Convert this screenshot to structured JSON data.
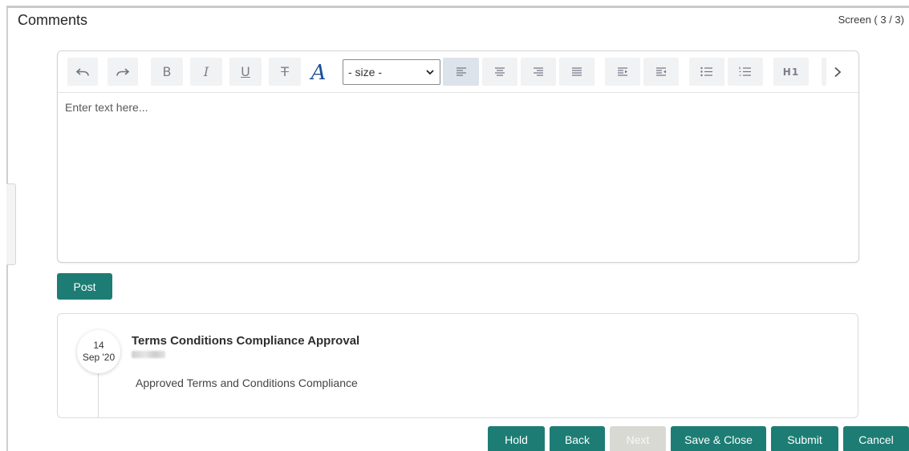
{
  "header": {
    "title": "Comments",
    "screen_indicator": "Screen ( 3 / 3)"
  },
  "editor": {
    "placeholder": "Enter text here...",
    "toolbar": {
      "size_select_value": "- size -",
      "heading_label": "H1",
      "font_color_glyph": "A",
      "tools": [
        {
          "name": "undo-icon"
        },
        {
          "name": "redo-icon"
        },
        {
          "name": "bold-icon",
          "glyph": "B"
        },
        {
          "name": "italic-icon",
          "glyph": "I"
        },
        {
          "name": "underline-icon",
          "glyph": "U"
        },
        {
          "name": "strikethrough-icon",
          "glyph": "T"
        },
        {
          "name": "font-color-icon"
        },
        {
          "name": "align-left-icon",
          "active": true
        },
        {
          "name": "align-center-icon"
        },
        {
          "name": "align-right-icon"
        },
        {
          "name": "align-justify-icon"
        },
        {
          "name": "indent-icon"
        },
        {
          "name": "outdent-icon"
        },
        {
          "name": "bullet-list-icon"
        },
        {
          "name": "numbered-list-icon"
        },
        {
          "name": "heading-icon"
        },
        {
          "name": "chevron-right-icon"
        }
      ]
    }
  },
  "actions": {
    "post_label": "Post"
  },
  "comments": [
    {
      "day": "14",
      "month_year": "Sep '20",
      "title": "Terms Conditions Compliance Approval",
      "text": "Approved Terms and Conditions Compliance"
    }
  ],
  "footer": {
    "hold": "Hold",
    "back": "Back",
    "next": "Next",
    "save_close": "Save & Close",
    "submit": "Submit",
    "cancel": "Cancel"
  },
  "colors": {
    "primary": "#1d7d74",
    "disabled": "#d9d9d4",
    "font_color_accent": "#1c4e9a"
  }
}
